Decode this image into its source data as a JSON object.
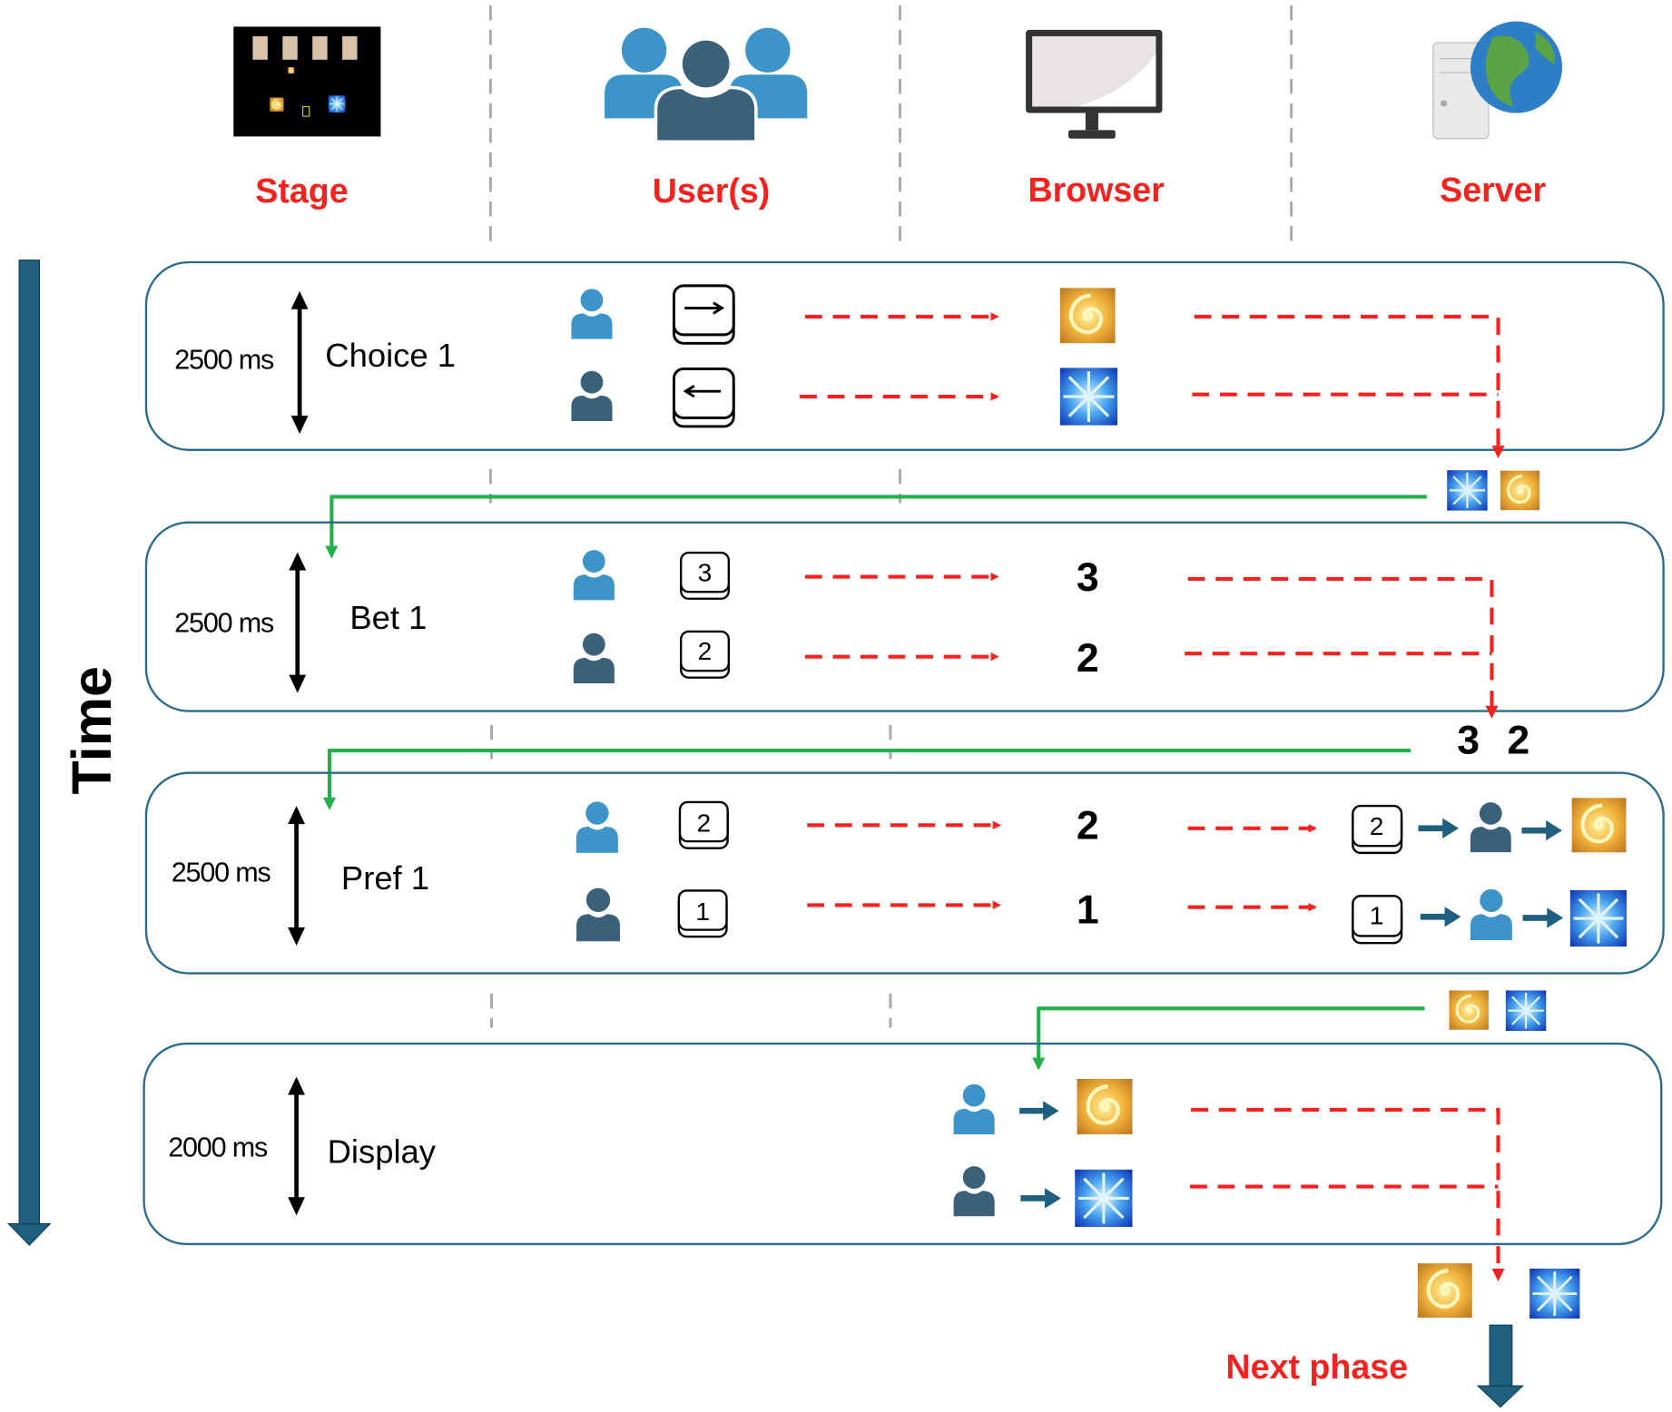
{
  "header": {
    "stage_label": "Stage",
    "users_label": "User(s)",
    "browser_label": "Browser",
    "server_label": "Server"
  },
  "time_label": "Time",
  "colors": {
    "header_text": "#f5231f",
    "box_border": "#2b6a8a",
    "time_arrow": "#1f5f7f",
    "request_arrow": "#f5231f",
    "response_line": "#22b04b",
    "user_light": "#3d94c8",
    "user_dark": "#3b6079"
  },
  "stages": [
    {
      "duration": "2500 ms",
      "name": "Choice 1",
      "keys": [
        "right-arrow-key",
        "left-arrow-key"
      ],
      "browser": [
        "spiral-image",
        "snowflake-image"
      ]
    },
    {
      "duration": "2500 ms",
      "name": "Bet 1",
      "keys": [
        "3",
        "2"
      ],
      "browser": [
        "3",
        "2"
      ],
      "server_result": [
        "3",
        "2"
      ]
    },
    {
      "duration": "2500 ms",
      "name": "Pref 1",
      "keys": [
        "2",
        "1"
      ],
      "browser": [
        "2",
        "1"
      ],
      "server_keys": [
        "2",
        "1"
      ]
    },
    {
      "duration": "2000 ms",
      "name": "Display"
    }
  ],
  "next_phase_label": "Next phase",
  "icons": [
    "stage-screenshot",
    "users-group-icon",
    "monitor-icon",
    "server-globe-icon",
    "user-icon",
    "keyboard-key-icon",
    "spiral-image",
    "snowflake-image"
  ]
}
